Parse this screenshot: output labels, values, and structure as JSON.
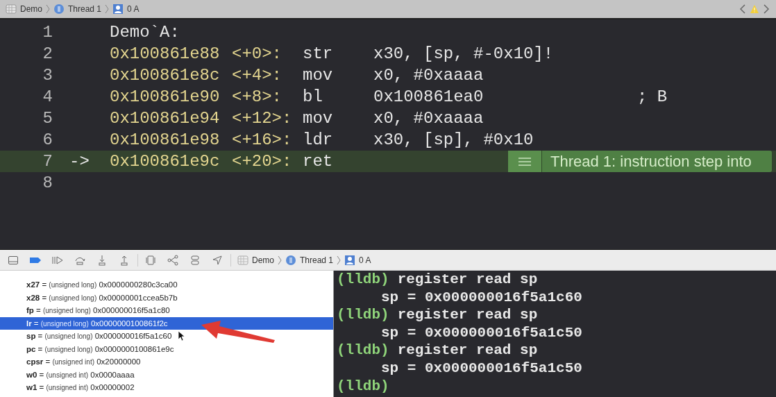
{
  "top_breadcrumb": [
    "Demo",
    "Thread 1",
    "0 A"
  ],
  "editor": {
    "lines": [
      {
        "number": "1",
        "label": "Demo`A:",
        "current": false
      },
      {
        "number": "2",
        "address": "0x100861e88",
        "offset": "<+0>:",
        "mnemonic": "str",
        "operands": "x30, [sp, #-0x10]!",
        "current": false
      },
      {
        "number": "3",
        "address": "0x100861e8c",
        "offset": "<+4>:",
        "mnemonic": "mov",
        "operands": "x0, #0xaaaa",
        "current": false
      },
      {
        "number": "4",
        "address": "0x100861e90",
        "offset": "<+8>:",
        "mnemonic": "bl",
        "operands": "0x100861ea0",
        "comment": "; B",
        "current": false
      },
      {
        "number": "5",
        "address": "0x100861e94",
        "offset": "<+12>:",
        "mnemonic": "mov",
        "operands": "x0, #0xaaaa",
        "current": false
      },
      {
        "number": "6",
        "address": "0x100861e98",
        "offset": "<+16>:",
        "mnemonic": "ldr",
        "operands": "x30, [sp], #0x10",
        "current": false
      },
      {
        "number": "7",
        "arrow": "->",
        "address": "0x100861e9c",
        "offset": "<+20>:",
        "mnemonic": "ret",
        "current": true
      },
      {
        "number": "8",
        "current": false
      }
    ],
    "annotation": "Thread 1: instruction step into"
  },
  "debug_breadcrumb": [
    "Demo",
    "Thread 1",
    "0 A"
  ],
  "variables": [
    {
      "name": "x27",
      "sign": "=",
      "type": "(unsigned long)",
      "value": "0x0000000280c3ca00",
      "selected": false
    },
    {
      "name": "x28",
      "sign": "=",
      "type": "(unsigned long)",
      "value": "0x00000001ccea5b7b",
      "selected": false
    },
    {
      "name": "fp",
      "sign": "=",
      "type": "(unsigned long)",
      "value": "0x000000016f5a1c80",
      "selected": false
    },
    {
      "name": "lr",
      "sign": "=",
      "type": "(unsigned long)",
      "value": "0x0000000100861f2c",
      "selected": true
    },
    {
      "name": "sp",
      "sign": "=",
      "type": "(unsigned long)",
      "value": "0x000000016f5a1c60",
      "selected": false
    },
    {
      "name": "pc",
      "sign": "=",
      "type": "(unsigned long)",
      "value": "0x0000000100861e9c",
      "selected": false
    },
    {
      "name": "cpsr",
      "sign": "=",
      "type": "(unsigned int)",
      "value": "0x20000000",
      "selected": false
    },
    {
      "name": "w0",
      "sign": "=",
      "type": "(unsigned int)",
      "value": "0x0000aaaa",
      "selected": false
    },
    {
      "name": "w1",
      "sign": "=",
      "type": "(unsigned int)",
      "value": "0x00000002",
      "selected": false
    }
  ],
  "console": [
    {
      "kind": "command",
      "prompt": "(lldb)",
      "text": "register read sp"
    },
    {
      "kind": "output",
      "text": "sp = 0x000000016f5a1c60"
    },
    {
      "kind": "command",
      "prompt": "(lldb)",
      "text": "register read sp"
    },
    {
      "kind": "output",
      "text": "sp = 0x000000016f5a1c50"
    },
    {
      "kind": "command",
      "prompt": "(lldb)",
      "text": "register read sp"
    },
    {
      "kind": "output",
      "text": "sp = 0x000000016f5a1c50"
    },
    {
      "kind": "command",
      "prompt": "(lldb)"
    }
  ]
}
